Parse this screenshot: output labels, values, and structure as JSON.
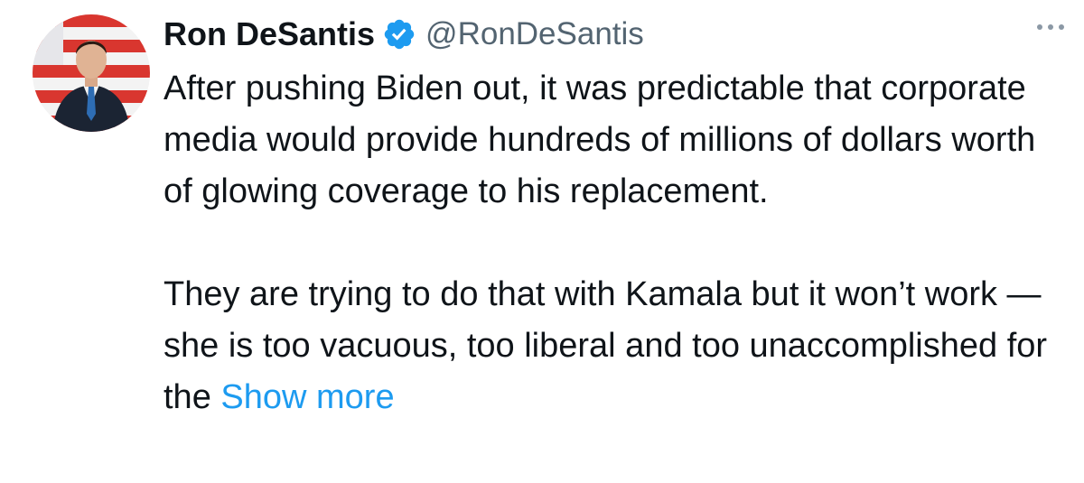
{
  "author": {
    "name": "Ron DeSantis",
    "handle": "@RonDeSantis",
    "verified_icon": "verified-badge-icon",
    "avatar": "profile-photo"
  },
  "tweet": {
    "paragraph_1": "After pushing Biden out, it was predictable that corporate media would provide hundreds of millions of dollars worth of glowing coverage to his replacement.",
    "paragraph_2": "They are trying to do that with Kamala but it won’t work — she is too vacuous, too liberal and too unaccomplished for the",
    "show_more_label": "Show more"
  },
  "menu": {
    "icon": "more-options-icon"
  },
  "colors": {
    "text": "#0f1419",
    "secondary": "#536471",
    "link": "#1d9bf0",
    "verified": "#1d9bf0"
  }
}
